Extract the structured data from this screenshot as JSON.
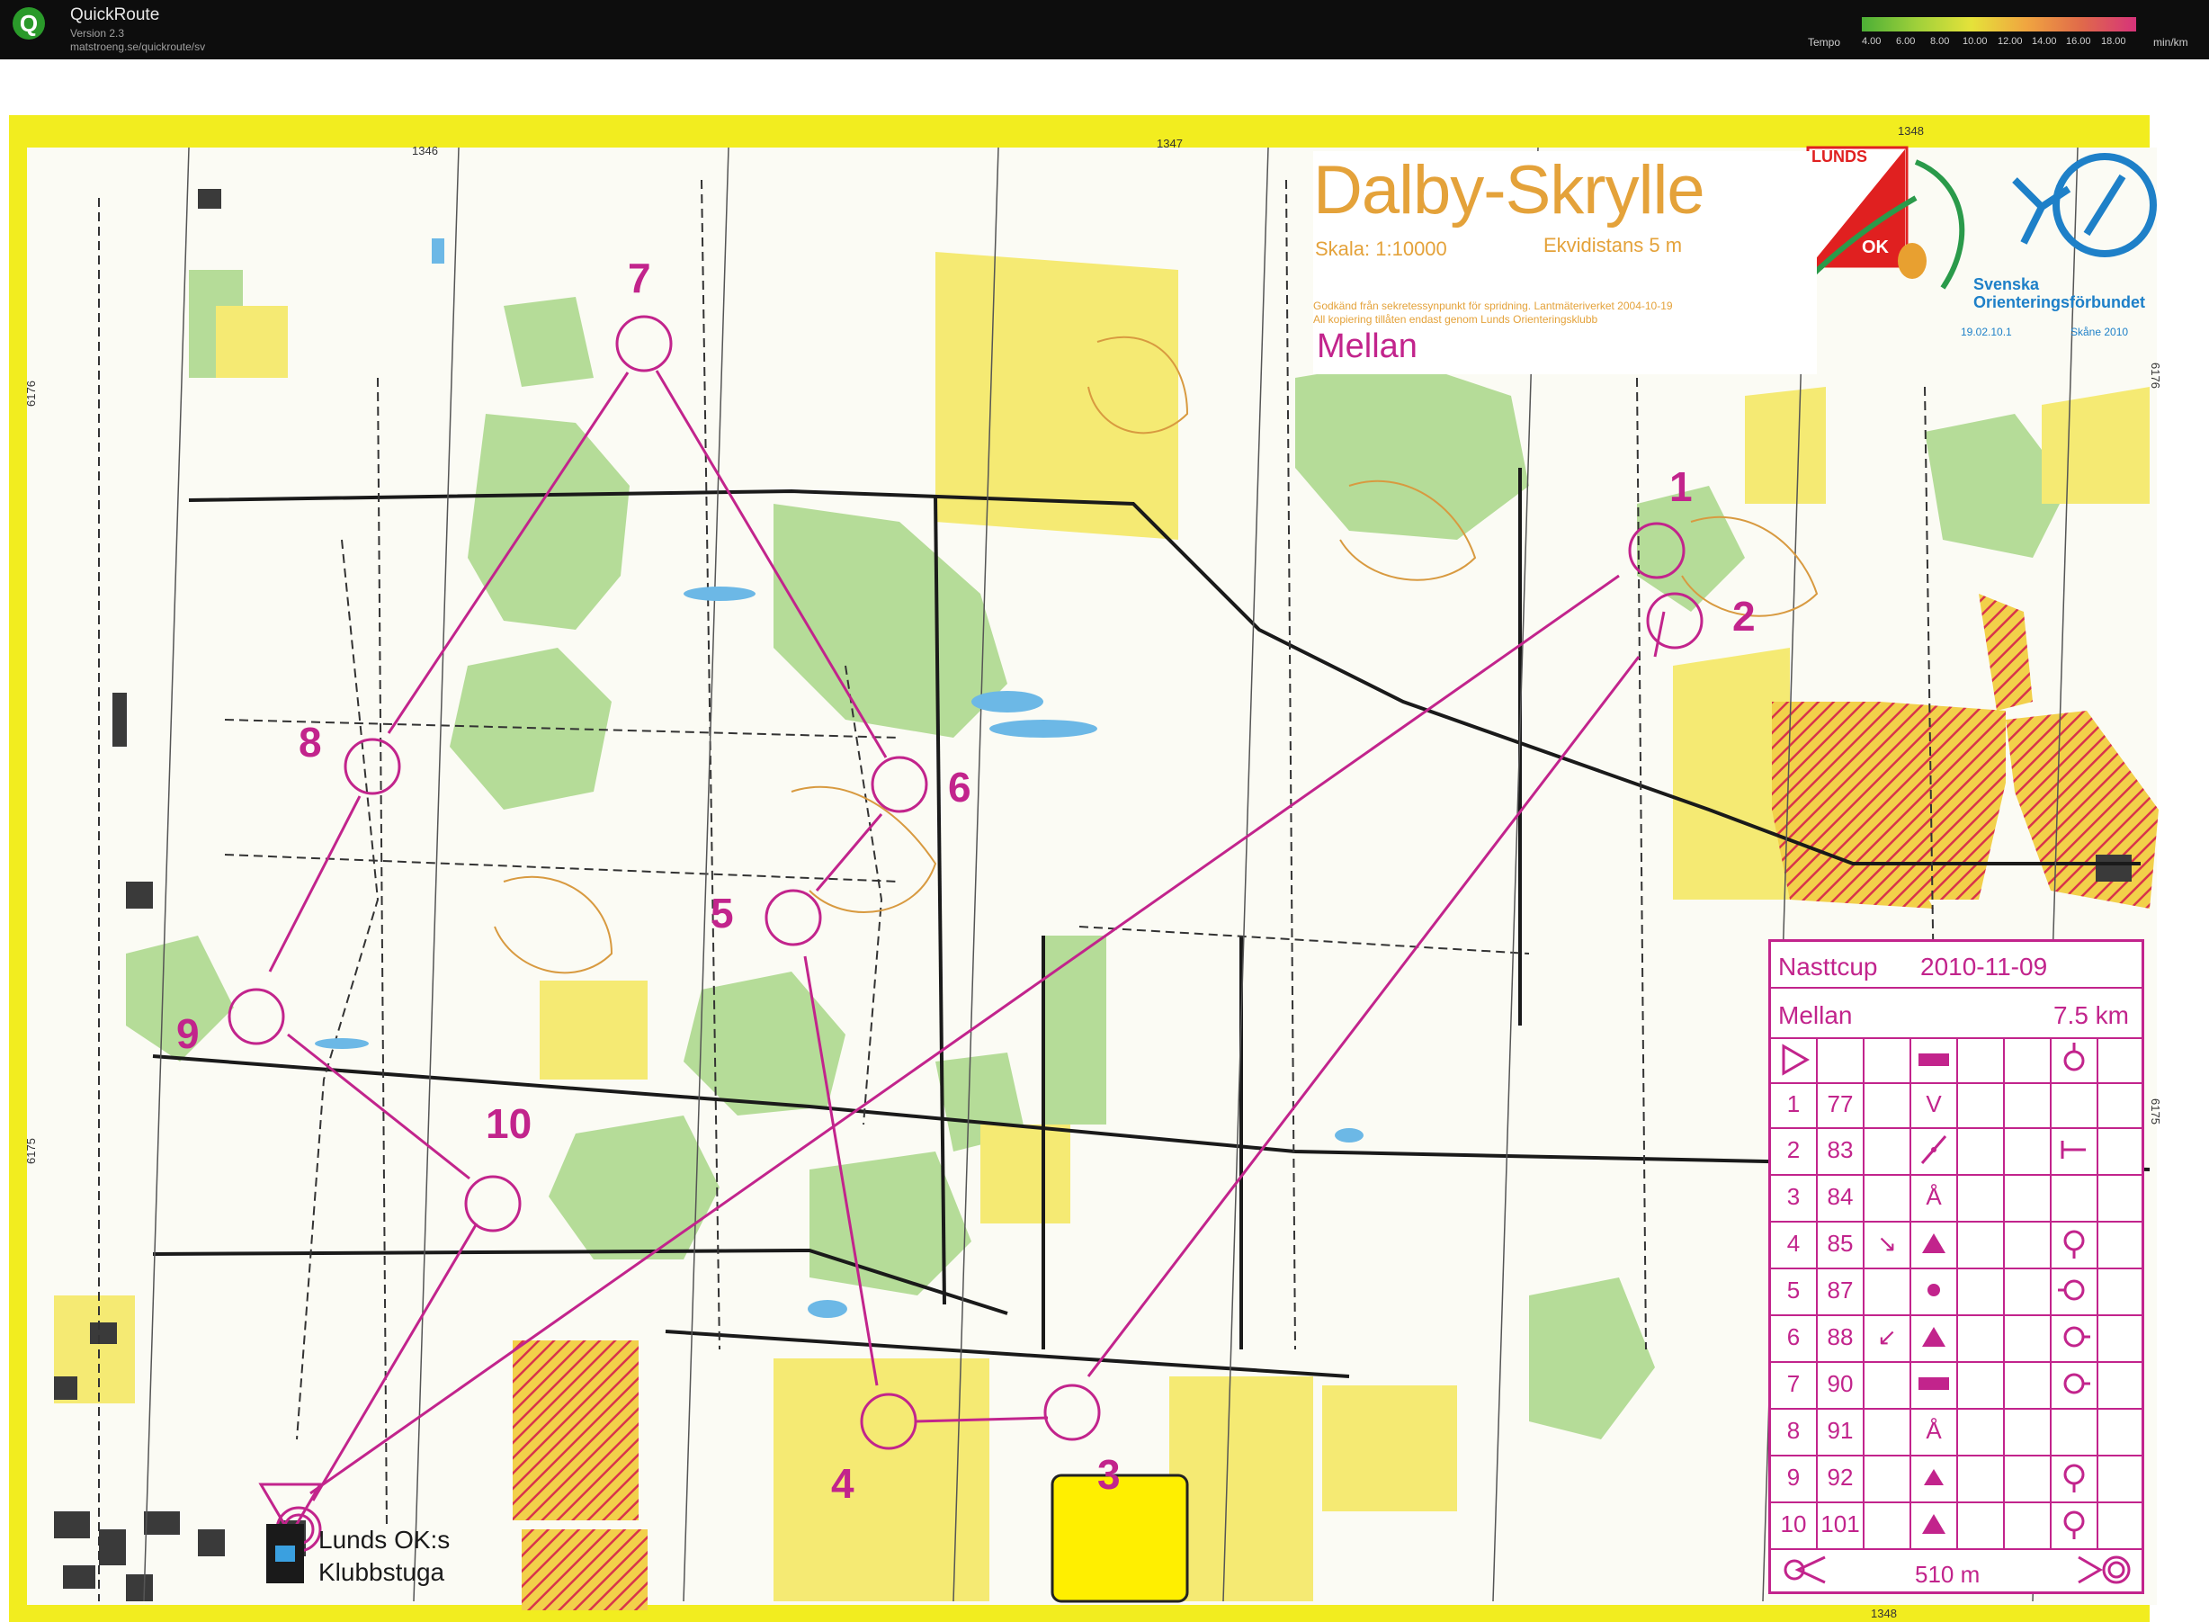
{
  "app": {
    "name": "QuickRoute",
    "version": "Version 2.3",
    "url": "matstroeng.se/quickroute/sv",
    "logo_letter": "Q"
  },
  "tempo_legend": {
    "label": "Tempo",
    "ticks": [
      "4.00",
      "6.00",
      "8.00",
      "10.00",
      "12.00",
      "14.00",
      "16.00",
      "18.00"
    ],
    "unit": "min/km"
  },
  "map": {
    "title": "Dalby-Skrylle",
    "scale": "Skala: 1:10000",
    "contour_interval": "Ekvidistans 5 m",
    "legal_line1": "Godkänd från sekretessynpunkt för spridning. Lantmäteriverket 2004-10-19",
    "legal_line2": "All kopiering tillåten endast genom Lunds Orienteringsklubb",
    "course": "Mellan",
    "club_logo_top": "LUNDS",
    "club_logo_bottom": "OK",
    "federation_line1": "Svenska",
    "federation_line2": "Orienteringsförbundet",
    "code_left": "19.02.10.1",
    "code_right": "Skåne 2010",
    "grid_labels": {
      "e1346": "1346",
      "e1347": "1347",
      "e1348": "1348",
      "e1348_bottom": "1348",
      "n6176": "6176",
      "n6175": "6175",
      "n6176_right": "6176",
      "n6175_right": "6175"
    },
    "finish_label_line1": "Lunds OK:s",
    "finish_label_line2": "Klubbstuga",
    "course_color": "#c2248c",
    "forest_green": "#a9d48c",
    "open_yellow": "#f6e85a"
  },
  "controls": [
    {
      "number": "1",
      "code": "77"
    },
    {
      "number": "2",
      "code": "83"
    },
    {
      "number": "3",
      "code": "84"
    },
    {
      "number": "4",
      "code": "85"
    },
    {
      "number": "5",
      "code": "87"
    },
    {
      "number": "6",
      "code": "88"
    },
    {
      "number": "7",
      "code": "90"
    },
    {
      "number": "8",
      "code": "91"
    },
    {
      "number": "9",
      "code": "92"
    },
    {
      "number": "10",
      "code": "101"
    }
  ],
  "description_sheet": {
    "event": "Nasttcup",
    "date": "2010-11-09",
    "course": "Mellan",
    "length": "7.5 km",
    "finish_distance": "510 m",
    "symbols": {
      "r1": "V",
      "r3": "Å",
      "r4_dir": "↘",
      "r6_dir": "↙",
      "r8": "Å"
    }
  }
}
